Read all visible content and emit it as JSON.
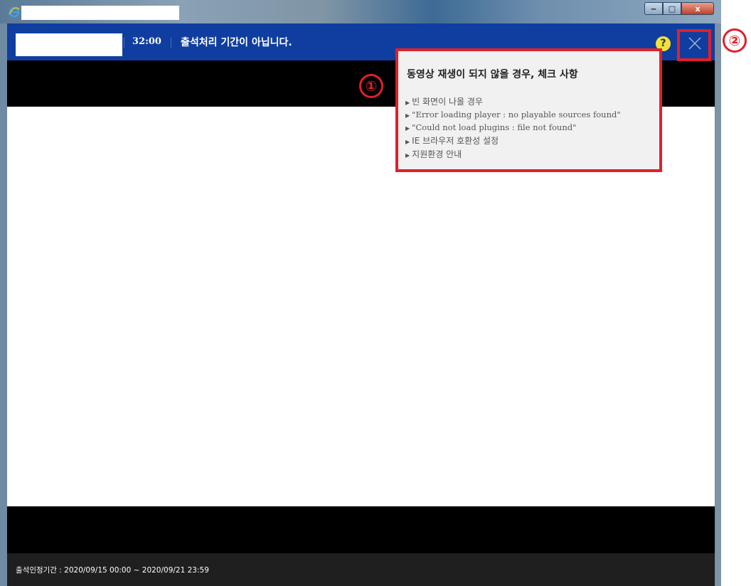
{
  "window": {
    "controls": {
      "minimize": "‒",
      "maximize": "□",
      "close": "x"
    }
  },
  "header": {
    "timer": "32:00",
    "status": "출석처리 기간이 아닙니다.",
    "help_label": "?"
  },
  "troubleshoot": {
    "title": "동영상 재생이 되지 않을 경우, 체크 사항",
    "items": [
      "빈 화면이 나올 경우",
      "\"Error loading player : no playable sources found\"",
      "\"Could not load plugins : file not found\"",
      "IE 브라우저 호환성 설정",
      "지원환경 안내"
    ]
  },
  "footer": {
    "attendance_period": "출석인정기간 : 2020/09/15 00:00 ~ 2020/09/21 23:59"
  },
  "annotations": {
    "marker_1": "①",
    "marker_2": "②"
  },
  "colors": {
    "header_bg": "#0f3ea0",
    "annotation": "#e0202a",
    "help_badge": "#f0e23a"
  }
}
